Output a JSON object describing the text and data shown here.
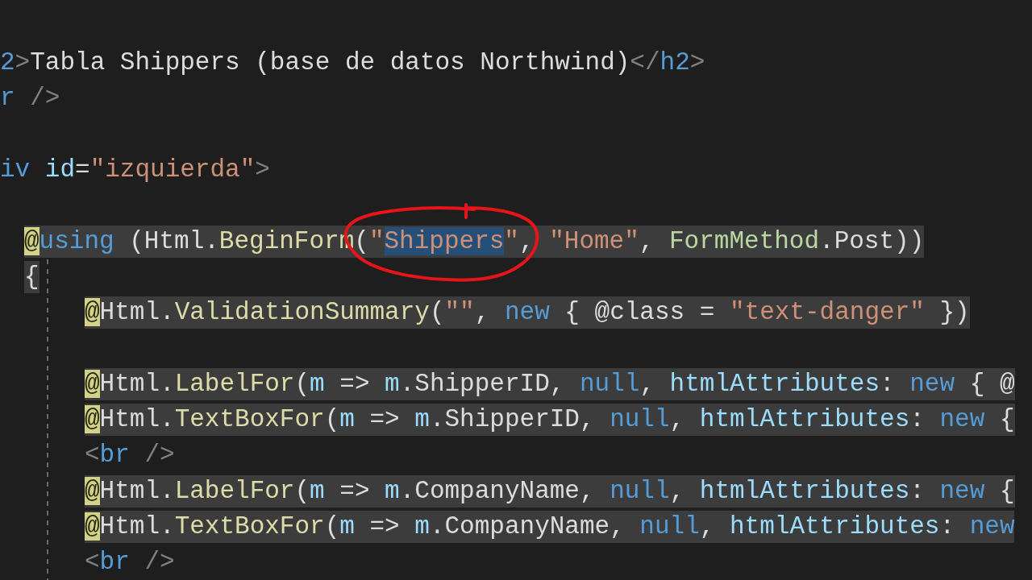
{
  "editor": {
    "lines": [
      {
        "kind": "code",
        "razor": false,
        "tokens": [
          {
            "text": "2",
            "kind": "element"
          },
          {
            "text": ">",
            "kind": "tag"
          },
          {
            "text": "Tabla Shippers (base de datos Northwind)",
            "kind": "text"
          },
          {
            "text": "</",
            "kind": "tag"
          },
          {
            "text": "h2",
            "kind": "element"
          },
          {
            "text": ">",
            "kind": "tag"
          }
        ]
      },
      {
        "kind": "code",
        "razor": false,
        "tokens": [
          {
            "text": "r",
            "kind": "element"
          },
          {
            "text": " />",
            "kind": "tag"
          }
        ]
      },
      {
        "kind": "blank"
      },
      {
        "kind": "code",
        "razor": false,
        "tokens": [
          {
            "text": "iv",
            "kind": "element"
          },
          {
            "text": " id",
            "kind": "attr"
          },
          {
            "text": "=",
            "kind": "plain"
          },
          {
            "text": "\"izquierda\"",
            "kind": "string"
          },
          {
            "text": ">",
            "kind": "tag"
          }
        ],
        "children": [
          {
            "kind": "blank"
          },
          {
            "kind": "code",
            "razor": true,
            "tokens": [
              {
                "text": "@",
                "kind": "at"
              },
              {
                "text": "using",
                "kind": "keyword"
              },
              {
                "text": " (Html.",
                "kind": "plain"
              },
              {
                "text": "BeginForm",
                "kind": "method"
              },
              {
                "text": "(",
                "kind": "plain"
              },
              {
                "text": "\"",
                "kind": "string"
              },
              {
                "text": "Shippers",
                "kind": "selection",
                "circled": true
              },
              {
                "text": "\"",
                "kind": "string"
              },
              {
                "text": ", ",
                "kind": "plain"
              },
              {
                "text": "\"Home\"",
                "kind": "string"
              },
              {
                "text": ", ",
                "kind": "plain"
              },
              {
                "text": "FormMethod",
                "kind": "type"
              },
              {
                "text": ".Post))",
                "kind": "plain"
              }
            ]
          },
          {
            "kind": "code",
            "razor": true,
            "tokens": [
              {
                "text": "{",
                "kind": "plain"
              }
            ],
            "children": [
              {
                "kind": "code",
                "razor": true,
                "tokens": [
                  {
                    "text": "@",
                    "kind": "at"
                  },
                  {
                    "text": "Html.",
                    "kind": "plain"
                  },
                  {
                    "text": "ValidationSummary",
                    "kind": "method"
                  },
                  {
                    "text": "(",
                    "kind": "plain"
                  },
                  {
                    "text": "\"\"",
                    "kind": "string"
                  },
                  {
                    "text": ", ",
                    "kind": "plain"
                  },
                  {
                    "text": "new",
                    "kind": "keyword"
                  },
                  {
                    "text": " { @class = ",
                    "kind": "plain"
                  },
                  {
                    "text": "\"text-danger\"",
                    "kind": "string"
                  },
                  {
                    "text": " })",
                    "kind": "plain"
                  }
                ]
              },
              {
                "kind": "blank"
              },
              {
                "kind": "code",
                "razor": true,
                "tokens": [
                  {
                    "text": "@",
                    "kind": "at"
                  },
                  {
                    "text": "Html.",
                    "kind": "plain"
                  },
                  {
                    "text": "LabelFor",
                    "kind": "method"
                  },
                  {
                    "text": "(",
                    "kind": "plain"
                  },
                  {
                    "text": "m",
                    "kind": "param"
                  },
                  {
                    "text": " => ",
                    "kind": "plain"
                  },
                  {
                    "text": "m",
                    "kind": "param"
                  },
                  {
                    "text": ".ShipperID, ",
                    "kind": "plain"
                  },
                  {
                    "text": "null",
                    "kind": "keyword"
                  },
                  {
                    "text": ", ",
                    "kind": "plain"
                  },
                  {
                    "text": "htmlAttributes",
                    "kind": "param"
                  },
                  {
                    "text": ": ",
                    "kind": "plain"
                  },
                  {
                    "text": "new",
                    "kind": "keyword"
                  },
                  {
                    "text": " { @",
                    "kind": "plain"
                  }
                ]
              },
              {
                "kind": "code",
                "razor": true,
                "tokens": [
                  {
                    "text": "@",
                    "kind": "at"
                  },
                  {
                    "text": "Html.",
                    "kind": "plain"
                  },
                  {
                    "text": "TextBoxFor",
                    "kind": "method"
                  },
                  {
                    "text": "(",
                    "kind": "plain"
                  },
                  {
                    "text": "m",
                    "kind": "param"
                  },
                  {
                    "text": " => ",
                    "kind": "plain"
                  },
                  {
                    "text": "m",
                    "kind": "param"
                  },
                  {
                    "text": ".ShipperID, ",
                    "kind": "plain"
                  },
                  {
                    "text": "null",
                    "kind": "keyword"
                  },
                  {
                    "text": ", ",
                    "kind": "plain"
                  },
                  {
                    "text": "htmlAttributes",
                    "kind": "param"
                  },
                  {
                    "text": ": ",
                    "kind": "plain"
                  },
                  {
                    "text": "new",
                    "kind": "keyword"
                  },
                  {
                    "text": " {",
                    "kind": "plain"
                  }
                ]
              },
              {
                "kind": "code",
                "razor": false,
                "tokens": [
                  {
                    "text": "<",
                    "kind": "tag"
                  },
                  {
                    "text": "br",
                    "kind": "element"
                  },
                  {
                    "text": " />",
                    "kind": "tag"
                  }
                ]
              },
              {
                "kind": "code",
                "razor": true,
                "tokens": [
                  {
                    "text": "@",
                    "kind": "at"
                  },
                  {
                    "text": "Html.",
                    "kind": "plain"
                  },
                  {
                    "text": "LabelFor",
                    "kind": "method"
                  },
                  {
                    "text": "(",
                    "kind": "plain"
                  },
                  {
                    "text": "m",
                    "kind": "param"
                  },
                  {
                    "text": " => ",
                    "kind": "plain"
                  },
                  {
                    "text": "m",
                    "kind": "param"
                  },
                  {
                    "text": ".CompanyName, ",
                    "kind": "plain"
                  },
                  {
                    "text": "null",
                    "kind": "keyword"
                  },
                  {
                    "text": ", ",
                    "kind": "plain"
                  },
                  {
                    "text": "htmlAttributes",
                    "kind": "param"
                  },
                  {
                    "text": ": ",
                    "kind": "plain"
                  },
                  {
                    "text": "new",
                    "kind": "keyword"
                  },
                  {
                    "text": " {",
                    "kind": "plain"
                  }
                ]
              },
              {
                "kind": "code",
                "razor": true,
                "tokens": [
                  {
                    "text": "@",
                    "kind": "at"
                  },
                  {
                    "text": "Html.",
                    "kind": "plain"
                  },
                  {
                    "text": "TextBoxFor",
                    "kind": "method"
                  },
                  {
                    "text": "(",
                    "kind": "plain"
                  },
                  {
                    "text": "m",
                    "kind": "param"
                  },
                  {
                    "text": " => ",
                    "kind": "plain"
                  },
                  {
                    "text": "m",
                    "kind": "param"
                  },
                  {
                    "text": ".CompanyName, ",
                    "kind": "plain"
                  },
                  {
                    "text": "null",
                    "kind": "keyword"
                  },
                  {
                    "text": ", ",
                    "kind": "plain"
                  },
                  {
                    "text": "htmlAttributes",
                    "kind": "param"
                  },
                  {
                    "text": ": ",
                    "kind": "plain"
                  },
                  {
                    "text": "new",
                    "kind": "keyword"
                  }
                ]
              },
              {
                "kind": "code",
                "razor": false,
                "tokens": [
                  {
                    "text": "<",
                    "kind": "tag"
                  },
                  {
                    "text": "br",
                    "kind": "element"
                  },
                  {
                    "text": " />",
                    "kind": "tag"
                  }
                ]
              }
            ]
          }
        ]
      }
    ]
  }
}
